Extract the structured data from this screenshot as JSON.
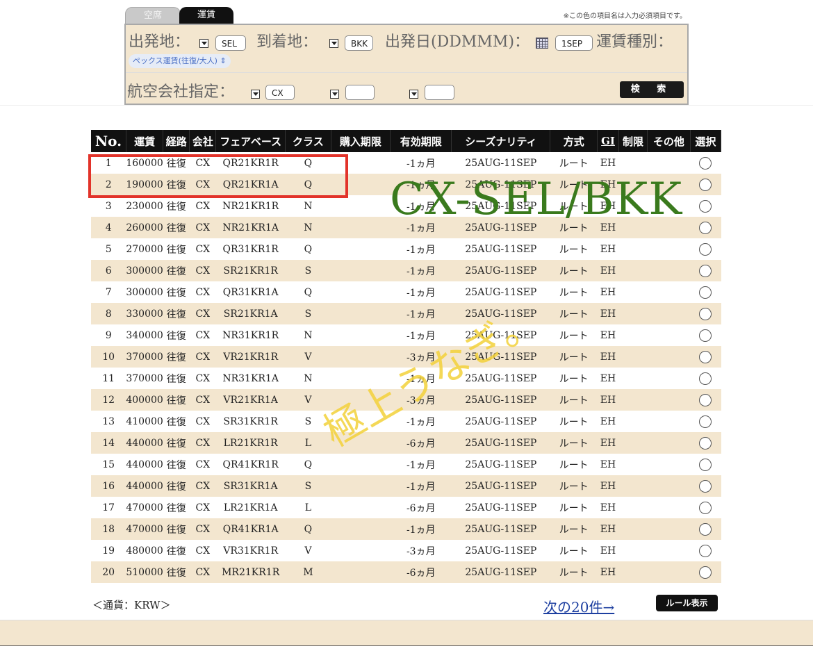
{
  "tabs": {
    "seats": "空席",
    "fares": "運賃"
  },
  "note": "※この色の項目名は入力必須項目です。",
  "search": {
    "origin_label": "出発地：",
    "origin_value": "SEL",
    "dest_label": "到着地：",
    "dest_value": "BKK",
    "date_label": "出発日(DDMMM)：",
    "date_value": "1SEP",
    "fare_type_label": "運賃種別：",
    "fare_type_value": "ペックス運賃(往復/大人)",
    "airline_label": "航空会社指定：",
    "airline_value": "CX",
    "airline_value_2": "",
    "airline_value_3": "",
    "search_button": "検 索"
  },
  "table": {
    "headers": [
      "No.",
      "運賃",
      "経路",
      "会社",
      "フェアベース",
      "クラス",
      "購入期限",
      "有効期限",
      "シーズナリティ",
      "方式",
      "GI",
      "制限",
      "その他",
      "選択"
    ],
    "rows": [
      [
        "1",
        "160000",
        "往復",
        "CX",
        "QR21KR1R",
        "Q",
        "",
        "-1ヵ月",
        "25AUG-11SEP",
        "ルート",
        "EH",
        "",
        ""
      ],
      [
        "2",
        "190000",
        "往復",
        "CX",
        "QR21KR1A",
        "Q",
        "",
        "-1ヵ月",
        "25AUG-11SEP",
        "ルート",
        "EH",
        "",
        ""
      ],
      [
        "3",
        "230000",
        "往復",
        "CX",
        "NR21KR1R",
        "N",
        "",
        "-1ヵ月",
        "25AUG-11SEP",
        "ルート",
        "EH",
        "",
        ""
      ],
      [
        "4",
        "260000",
        "往復",
        "CX",
        "NR21KR1A",
        "N",
        "",
        "-1ヵ月",
        "25AUG-11SEP",
        "ルート",
        "EH",
        "",
        ""
      ],
      [
        "5",
        "270000",
        "往復",
        "CX",
        "QR31KR1R",
        "Q",
        "",
        "-1ヵ月",
        "25AUG-11SEP",
        "ルート",
        "EH",
        "",
        ""
      ],
      [
        "6",
        "300000",
        "往復",
        "CX",
        "SR21KR1R",
        "S",
        "",
        "-1ヵ月",
        "25AUG-11SEP",
        "ルート",
        "EH",
        "",
        ""
      ],
      [
        "7",
        "300000",
        "往復",
        "CX",
        "QR31KR1A",
        "Q",
        "",
        "-1ヵ月",
        "25AUG-11SEP",
        "ルート",
        "EH",
        "",
        ""
      ],
      [
        "8",
        "330000",
        "往復",
        "CX",
        "SR21KR1A",
        "S",
        "",
        "-1ヵ月",
        "25AUG-11SEP",
        "ルート",
        "EH",
        "",
        ""
      ],
      [
        "9",
        "340000",
        "往復",
        "CX",
        "NR31KR1R",
        "N",
        "",
        "-1ヵ月",
        "25AUG-11SEP",
        "ルート",
        "EH",
        "",
        ""
      ],
      [
        "10",
        "370000",
        "往復",
        "CX",
        "VR21KR1R",
        "V",
        "",
        "-3ヵ月",
        "25AUG-11SEP",
        "ルート",
        "EH",
        "",
        ""
      ],
      [
        "11",
        "370000",
        "往復",
        "CX",
        "NR31KR1A",
        "N",
        "",
        "-1ヵ月",
        "25AUG-11SEP",
        "ルート",
        "EH",
        "",
        ""
      ],
      [
        "12",
        "400000",
        "往復",
        "CX",
        "VR21KR1A",
        "V",
        "",
        "-3ヵ月",
        "25AUG-11SEP",
        "ルート",
        "EH",
        "",
        ""
      ],
      [
        "13",
        "410000",
        "往復",
        "CX",
        "SR31KR1R",
        "S",
        "",
        "-1ヵ月",
        "25AUG-11SEP",
        "ルート",
        "EH",
        "",
        ""
      ],
      [
        "14",
        "440000",
        "往復",
        "CX",
        "LR21KR1R",
        "L",
        "",
        "-6ヵ月",
        "25AUG-11SEP",
        "ルート",
        "EH",
        "",
        ""
      ],
      [
        "15",
        "440000",
        "往復",
        "CX",
        "QR41KR1R",
        "Q",
        "",
        "-1ヵ月",
        "25AUG-11SEP",
        "ルート",
        "EH",
        "",
        ""
      ],
      [
        "16",
        "440000",
        "往復",
        "CX",
        "SR31KR1A",
        "S",
        "",
        "-1ヵ月",
        "25AUG-11SEP",
        "ルート",
        "EH",
        "",
        ""
      ],
      [
        "17",
        "470000",
        "往復",
        "CX",
        "LR21KR1A",
        "L",
        "",
        "-6ヵ月",
        "25AUG-11SEP",
        "ルート",
        "EH",
        "",
        ""
      ],
      [
        "18",
        "470000",
        "往復",
        "CX",
        "QR41KR1A",
        "Q",
        "",
        "-1ヵ月",
        "25AUG-11SEP",
        "ルート",
        "EH",
        "",
        ""
      ],
      [
        "19",
        "480000",
        "往復",
        "CX",
        "VR31KR1R",
        "V",
        "",
        "-3ヵ月",
        "25AUG-11SEP",
        "ルート",
        "EH",
        "",
        ""
      ],
      [
        "20",
        "510000",
        "往復",
        "CX",
        "MR21KR1R",
        "M",
        "",
        "-6ヵ月",
        "25AUG-11SEP",
        "ルート",
        "EH",
        "",
        ""
      ]
    ]
  },
  "overlays": {
    "route_text": "CX-SEL/BKK",
    "comment_text": "極上うなぎ。",
    "highlight_color": "#e2332a"
  },
  "footer": {
    "currency": "＜通貨：KRW＞",
    "next_link": "次の20件→",
    "rule_button": "ルール表示"
  },
  "colors": {
    "row_alt": "#f3e6cf",
    "header_bg": "#111111",
    "link": "#1d3fa0"
  }
}
